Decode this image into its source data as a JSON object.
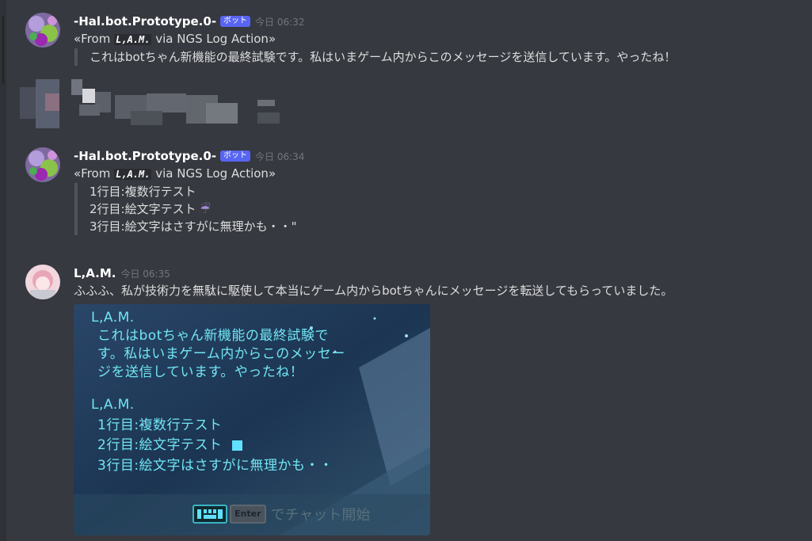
{
  "colors": {
    "background": "#36393f",
    "bot_badge": "#5865f2",
    "game_text": "#71e5f3"
  },
  "messages": [
    {
      "username": "-Hal.bot.Prototype.0-",
      "badge": "ボット",
      "timestamp": "今日 06:32",
      "from_prefix": "«From",
      "from_name": "L,A.M.",
      "from_suffix": "via NGS Log Action»",
      "quote_lines": [
        "これはbotちゃん新機能の最終試験です。私はいまゲーム内からこのメッセージを送信しています。やったね！"
      ]
    },
    {
      "username": "-Hal.bot.Prototype.0-",
      "badge": "ボット",
      "timestamp": "今日 06:34",
      "from_prefix": "«From",
      "from_name": "L,A.M.",
      "from_suffix": "via NGS Log Action»",
      "quote_lines": [
        "1行目:複数行テスト",
        "2行目:絵文字テスト",
        "3行目:絵文字はさすがに無理かも・・\""
      ],
      "emoji": "☔"
    },
    {
      "username": "L,A.M.",
      "timestamp": "今日 06:35",
      "text": "ふふふ、私が技術力を無駄に駆使して本当にゲーム内からbotちゃんにメッセージを転送してもらっていました。",
      "attachment": {
        "block1_name": "L,A.M.",
        "block1_lines": [
          "これはbotちゃん新機能の最終試験で",
          "す。私はいまゲーム内からこのメッセー",
          "ジを送信しています。やったね！"
        ],
        "block2_name": "L,A.M.",
        "block2_lines": [
          "1行目:複数行テスト",
          "2行目:絵文字テスト",
          "3行目:絵文字はさすがに無理かも・・"
        ],
        "enter_key": "Enter",
        "chat_hint": "でチャット開始"
      }
    }
  ]
}
